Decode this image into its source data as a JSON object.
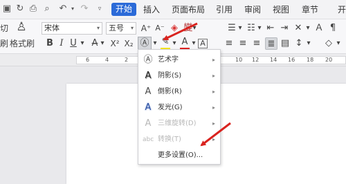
{
  "menubar": {
    "tabs": {
      "start": "开始",
      "insert": "插入",
      "layout": "页面布局",
      "references": "引用",
      "review": "审阅",
      "view": "视图",
      "section": "章节",
      "dev": "开"
    }
  },
  "toolbar": {
    "font_name": "宋体",
    "font_size": "五号",
    "format_painter": "格式刷",
    "left_cut": "切",
    "left_cut2": "刷"
  },
  "ruler": {
    "numbers": [
      "6",
      "4",
      "2",
      "10",
      "12",
      "14",
      "16",
      "18",
      "20"
    ]
  },
  "effects_menu": {
    "items": [
      {
        "label": "艺术字",
        "icon": "art-text-icon"
      },
      {
        "label": "阴影(S)",
        "icon": "shadow-icon"
      },
      {
        "label": "倒影(R)",
        "icon": "reflection-icon"
      },
      {
        "label": "发光(G)",
        "icon": "glow-icon"
      },
      {
        "label": "三维旋转(D)",
        "icon": "3d-rotate-icon"
      },
      {
        "label": "转换(T)",
        "icon": "transform-icon"
      },
      {
        "label": "更多设置(O)..."
      }
    ]
  },
  "colors": {
    "accent": "#2b6ad8",
    "arrow": "#d9231f",
    "highlight": "#f5e61a",
    "font_color": "#e02020"
  }
}
